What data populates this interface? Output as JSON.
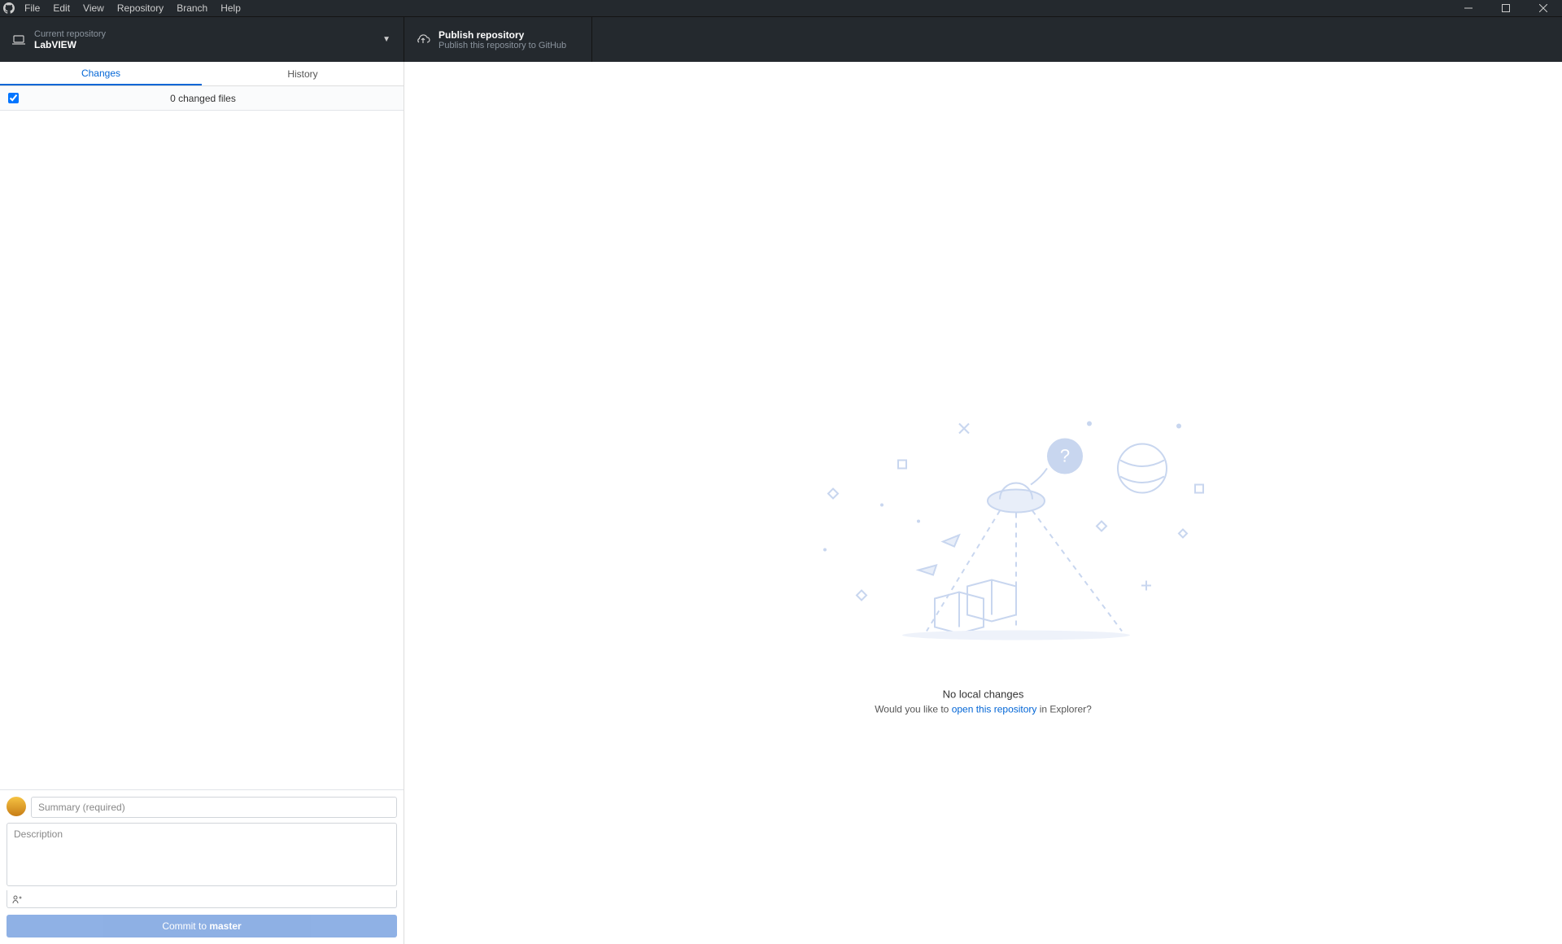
{
  "menu": [
    "File",
    "Edit",
    "View",
    "Repository",
    "Branch",
    "Help"
  ],
  "toolbar": {
    "repo_label": "Current repository",
    "repo_name": "LabVIEW",
    "publish_title": "Publish repository",
    "publish_sub": "Publish this repository to GitHub"
  },
  "sidebar": {
    "tabs": {
      "changes": "Changes",
      "history": "History"
    },
    "changed_files_label": "0 changed files"
  },
  "commit": {
    "summary_placeholder": "Summary (required)",
    "description_placeholder": "Description",
    "button_prefix": "Commit to ",
    "button_branch": "master"
  },
  "empty": {
    "title": "No local changes",
    "prefix": "Would you like to ",
    "link": "open this repository",
    "suffix": " in Explorer?"
  }
}
